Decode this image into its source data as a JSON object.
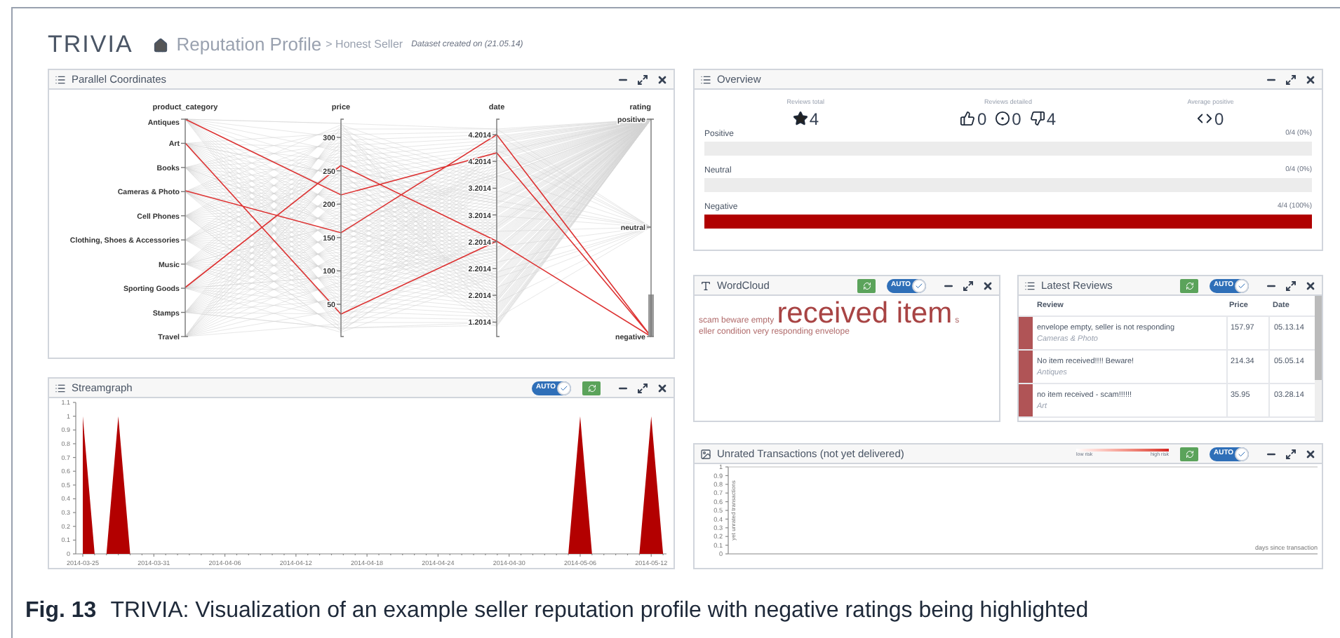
{
  "header": {
    "logo": "TRIVIA",
    "title": "Reputation Profile",
    "breadcrumb": "> Honest Seller",
    "dataset_note": "Dataset created on (21.05.14)"
  },
  "parallel_coordinates": {
    "title": "Parallel Coordinates",
    "axes": [
      {
        "name": "product_category",
        "ticks": [
          "Antiques",
          "Art",
          "Books",
          "Cameras & Photo",
          "Cell Phones",
          "Clothing, Shoes & Accessories",
          "Music",
          "Sporting Goods",
          "Stamps",
          "Travel"
        ]
      },
      {
        "name": "price",
        "ticks": [
          "300",
          "250",
          "200",
          "150",
          "100",
          "50"
        ]
      },
      {
        "name": "date",
        "ticks": [
          "4.2014",
          "4.2014",
          "3.2014",
          "3.2014",
          "2.2014",
          "2.2014",
          "2.2014",
          "1.2014"
        ]
      },
      {
        "name": "rating",
        "ticks": [
          "positive",
          "neutral",
          "negative"
        ]
      }
    ]
  },
  "streamgraph": {
    "title": "Streamgraph",
    "auto": {
      "label": "AUTO",
      "on": true
    },
    "chart_data": {
      "type": "area",
      "categories": [
        "2014-03-25",
        null,
        null,
        null,
        null,
        null,
        "2014-03-31",
        null,
        null,
        null,
        null,
        null,
        "2014-04-06",
        null,
        null,
        null,
        null,
        null,
        "2014-04-12",
        null,
        null,
        null,
        null,
        null,
        "2014-04-18",
        null,
        null,
        null,
        null,
        null,
        "2014-04-24",
        null,
        null,
        null,
        null,
        null,
        "2014-04-30",
        null,
        null,
        null,
        null,
        null,
        "2014-05-06",
        null,
        null,
        null,
        null,
        null,
        "2014-05-12",
        null
      ],
      "series": [
        {
          "color": "#b30000",
          "values": [
            1,
            0,
            0,
            1,
            0,
            0,
            0,
            0,
            0,
            0,
            0,
            0,
            0,
            0,
            0,
            0,
            0,
            0,
            0,
            0,
            0,
            0,
            0,
            0,
            0,
            0,
            0,
            0,
            0,
            0,
            0,
            0,
            0,
            0,
            0,
            0,
            0,
            0,
            0,
            0,
            0,
            0,
            1,
            0,
            0,
            0,
            0,
            0,
            1,
            0
          ]
        }
      ],
      "ylim": [
        0,
        1.1
      ],
      "yticks": [
        0,
        0.1,
        0.2,
        0.3,
        0.4,
        0.5,
        0.6,
        0.7,
        0.8,
        0.9,
        1,
        1.1
      ]
    }
  },
  "overview": {
    "title": "Overview",
    "stats": [
      {
        "label": "Reviews total",
        "items": [
          {
            "kind": "star",
            "value": "4"
          }
        ]
      },
      {
        "label": "Reviews detailed",
        "items": [
          {
            "kind": "thumbs-up",
            "value": "0"
          },
          {
            "kind": "neutral",
            "value": "0"
          },
          {
            "kind": "thumbs-down",
            "value": "4"
          }
        ]
      },
      {
        "label": "Average positive",
        "items": [
          {
            "kind": "code",
            "value": "0"
          }
        ]
      }
    ],
    "bars": [
      {
        "label": "Positive",
        "reading": "0/4 (0%)"
      },
      {
        "label": "Neutral",
        "reading": "0/4 (0%)"
      },
      {
        "label": "Negative",
        "reading": "4/4 (100%)",
        "level": 1
      }
    ]
  },
  "wordcloud": {
    "title": "WordCloud",
    "auto": {
      "label": "AUTO",
      "on": true
    },
    "lines": [
      [
        {
          "text": "scam beware empty",
          "kind": "small"
        },
        {
          "text": "received item",
          "kind": "large"
        },
        {
          "text": "s",
          "kind": "small"
        }
      ],
      [
        {
          "text": "eller condition very responding envelope",
          "kind": "small"
        }
      ]
    ]
  },
  "latest_reviews": {
    "title": "Latest Reviews",
    "auto": {
      "label": "AUTO",
      "on": true
    },
    "columns": [
      "Review",
      "Price",
      "Date"
    ],
    "rows": [
      {
        "review": "envelope empty, seller is not responding",
        "category": "Cameras & Photo",
        "price": "157.97",
        "date": "05.13.14",
        "color": "#b05456"
      },
      {
        "review": "No item received!!!! Beware!",
        "category": "Antiques",
        "price": "214.34",
        "date": "05.05.14",
        "color": "#b05456"
      },
      {
        "review": "no item received - scam!!!!!!",
        "category": "Art",
        "price": "35.95",
        "date": "03.28.14",
        "color": "#b05456"
      }
    ]
  },
  "unrated_transactions": {
    "title": "Unrated Transactions (not yet delivered)",
    "legend": {
      "low": "low risk",
      "high": "high risk"
    },
    "auto": {
      "label": "AUTO",
      "on": true
    },
    "plot": {
      "xlabel": "days since transaction",
      "ylabel": "yet unrated transactions",
      "yticks": [
        "1",
        "0.9",
        "0.8",
        "0.7",
        "0.6",
        "0.5",
        "0.4",
        "0.3",
        "0.2",
        "0.1",
        "0"
      ]
    }
  },
  "caption": {
    "label": "Fig. 13",
    "text": "TRIVIA: Visualization of an example seller reputation profile with negative ratings being highlighted"
  }
}
